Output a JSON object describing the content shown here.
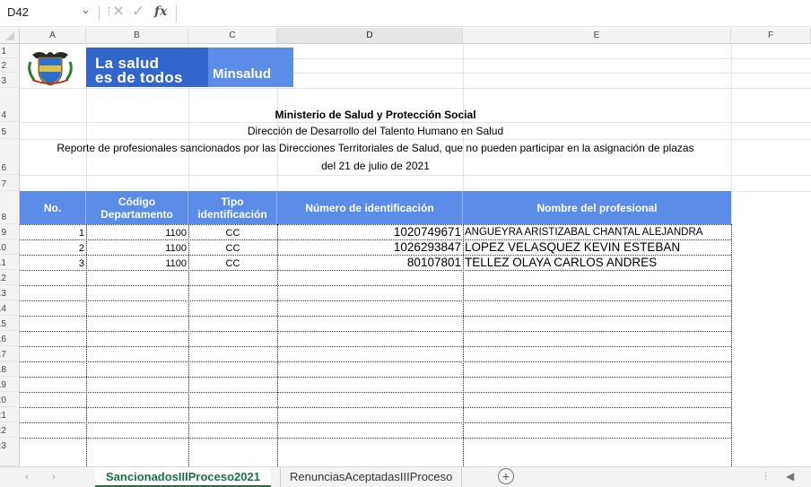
{
  "formula_bar": {
    "name_box": "D42",
    "dropdown_icon": "chevron-down-icon",
    "fx": "fx"
  },
  "columns": [
    "A",
    "B",
    "C",
    "D",
    "E",
    "F"
  ],
  "rows": [
    "1",
    "2",
    "3",
    "4",
    "5",
    "6",
    "7",
    "8",
    "9",
    ".0",
    ".1",
    ".2",
    ".3",
    ".4",
    ".5",
    ".6",
    ".7",
    ".8",
    ".9",
    ":0",
    ":1",
    ":2",
    ":3"
  ],
  "banner": {
    "logo": "coat-of-arms",
    "slogan_line1": "La salud",
    "slogan_line2": "es de todos",
    "brand": "Minsalud",
    "colors": {
      "blue": "#3366cc",
      "light_blue": "#5b8ce8"
    }
  },
  "report": {
    "title": "Ministerio de Salud y Protección Social",
    "subtitle": "Dirección de Desarrollo del Talento Humano en Salud",
    "description_line1": "Reporte de profesionales sancionados por las Direcciones Territoriales de Salud, que no pueden participar en la asignación de plazas",
    "description_line2": "del 21 de julio de 2021"
  },
  "table": {
    "headers": {
      "no": "No.",
      "dept_line1": "Código",
      "dept_line2": "Departamento",
      "tipo_line1": "Tipo",
      "tipo_line2": "identificación",
      "numero": "Número de identificación",
      "nombre": "Nombre del profesional"
    },
    "rows": [
      {
        "no": "1",
        "dept": "1100",
        "tipo": "CC",
        "numero": "1020749671",
        "nombre": "ANGUEYRA ARISTIZABAL CHANTAL ALEJANDRA"
      },
      {
        "no": "2",
        "dept": "1100",
        "tipo": "CC",
        "numero": "1026293847",
        "nombre": "LOPEZ VELASQUEZ KEVIN ESTEBAN"
      },
      {
        "no": "3",
        "dept": "1100",
        "tipo": "CC",
        "numero": "80107801",
        "nombre": "TELLEZ OLAYA CARLOS ANDRES"
      }
    ],
    "header_color": "#5b8ce8"
  },
  "sheet_tabs": {
    "active": "SancionadosIIIProceso2021",
    "inactive": "RenunciasAceptadasIIIProceso",
    "add_icon": "plus-circle-icon",
    "active_color": "#1e7145"
  }
}
